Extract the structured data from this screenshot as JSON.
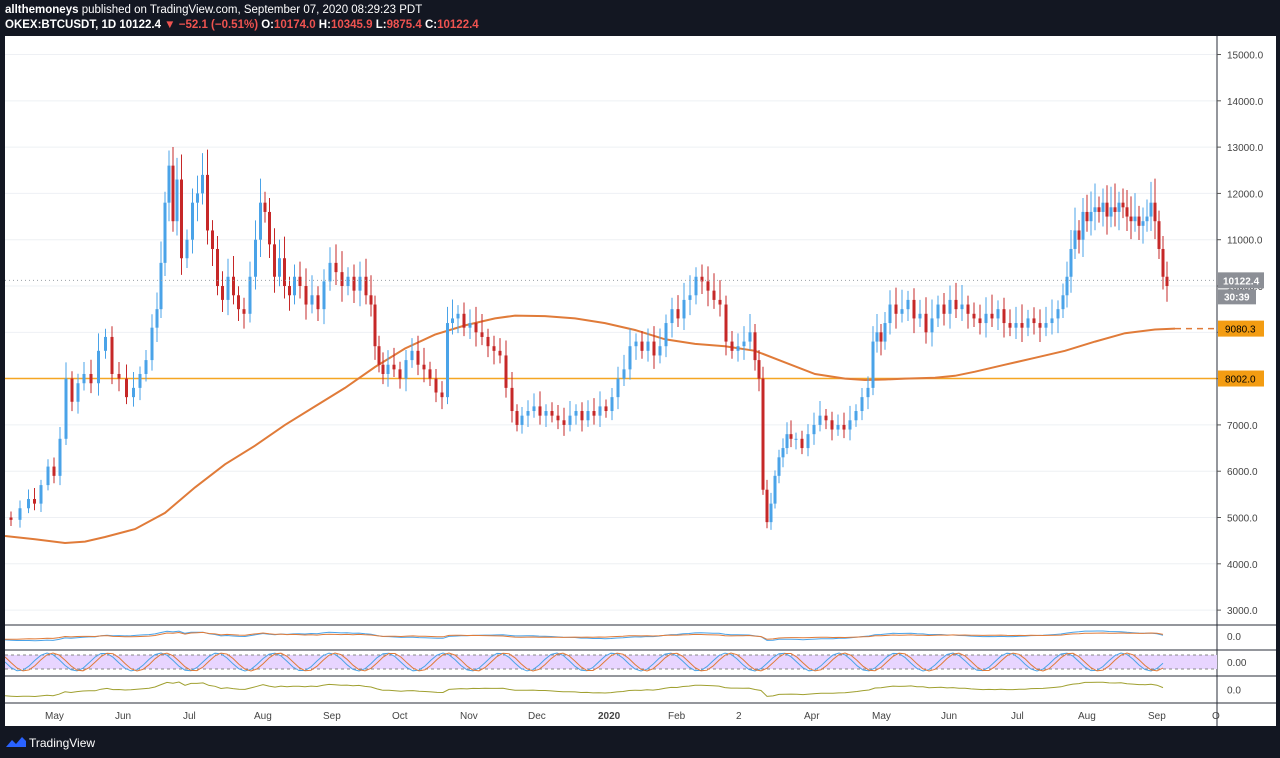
{
  "header": {
    "user": "allthemoneys",
    "published": "published on TradingView.com, September 07, 2020 08:29:23 PDT",
    "symbol": "OKEX:BTCUSDT, 1D",
    "last": "10122.4",
    "change": "▼ −52.1 (−0.51%)",
    "o_label": "O:",
    "o": "10174.0",
    "h_label": "H:",
    "h": "10345.9",
    "l_label": "L:",
    "l": "9875.4",
    "c_label": "C:",
    "c": "10122.4"
  },
  "footer": {
    "brand": "TradingView"
  },
  "colors": {
    "up": "#4aa3e8",
    "down": "#c62828",
    "ma": "#e07b39",
    "level": "#f5a623"
  },
  "chart_data": {
    "type": "candlestick",
    "ylim": [
      2700,
      15400
    ],
    "yticks": [
      "15000.0",
      "14000.0",
      "13000.0",
      "12000.0",
      "11000.0",
      "10000.0",
      "9000.0",
      "8000.0",
      "7000.0",
      "6000.0",
      "5000.0",
      "4000.0",
      "3000.0"
    ],
    "xticks": [
      "May",
      "Jun",
      "Jul",
      "Aug",
      "Sep",
      "Oct",
      "Nov",
      "Dec",
      "2020",
      "Feb",
      "2",
      "Apr",
      "May",
      "Jun",
      "Jul",
      "Aug",
      "Sep",
      "O"
    ],
    "price_label": "10122.4",
    "countdown": "30:39",
    "ma_label": "9080.3",
    "level_label": "8002.0",
    "level": 8002,
    "price_path": [
      [
        0,
        5000
      ],
      [
        8,
        4950
      ],
      [
        18,
        5200
      ],
      [
        25,
        5400
      ],
      [
        30,
        5300
      ],
      [
        38,
        5700
      ],
      [
        44,
        6100
      ],
      [
        50,
        5900
      ],
      [
        56,
        6700
      ],
      [
        62,
        8000
      ],
      [
        68,
        7500
      ],
      [
        74,
        7900
      ],
      [
        80,
        8100
      ],
      [
        88,
        7900
      ],
      [
        95,
        8600
      ],
      [
        102,
        8900
      ],
      [
        108,
        8100
      ],
      [
        116,
        8000
      ],
      [
        123,
        7600
      ],
      [
        130,
        7800
      ],
      [
        136,
        8100
      ],
      [
        142,
        8400
      ],
      [
        148,
        9100
      ],
      [
        152,
        9500
      ],
      [
        156,
        10500
      ],
      [
        160,
        11800
      ],
      [
        164,
        12600
      ],
      [
        168,
        11400
      ],
      [
        172,
        12300
      ],
      [
        177,
        10600
      ],
      [
        183,
        11000
      ],
      [
        188,
        11800
      ],
      [
        193,
        12000
      ],
      [
        198,
        12400
      ],
      [
        203,
        11200
      ],
      [
        208,
        10800
      ],
      [
        213,
        10000
      ],
      [
        218,
        9700
      ],
      [
        224,
        10200
      ],
      [
        229,
        9800
      ],
      [
        234,
        9500
      ],
      [
        240,
        9400
      ],
      [
        246,
        10200
      ],
      [
        251,
        11000
      ],
      [
        256,
        11800
      ],
      [
        260,
        11600
      ],
      [
        265,
        10900
      ],
      [
        270,
        10200
      ],
      [
        275,
        10600
      ],
      [
        280,
        10000
      ],
      [
        285,
        9800
      ],
      [
        290,
        10200
      ],
      [
        296,
        10000
      ],
      [
        302,
        9600
      ],
      [
        308,
        9800
      ],
      [
        314,
        9500
      ],
      [
        320,
        10100
      ],
      [
        326,
        10500
      ],
      [
        332,
        10300
      ],
      [
        338,
        10000
      ],
      [
        344,
        10200
      ],
      [
        350,
        9900
      ],
      [
        356,
        10200
      ],
      [
        362,
        9800
      ],
      [
        366,
        9600
      ],
      [
        370,
        8700
      ],
      [
        374,
        8300
      ],
      [
        378,
        8100
      ],
      [
        384,
        8300
      ],
      [
        390,
        8200
      ],
      [
        396,
        8000
      ],
      [
        402,
        8400
      ],
      [
        408,
        8600
      ],
      [
        414,
        8300
      ],
      [
        420,
        8200
      ],
      [
        426,
        8000
      ],
      [
        432,
        7700
      ],
      [
        438,
        7600
      ],
      [
        443,
        9200
      ],
      [
        448,
        9300
      ],
      [
        454,
        9400
      ],
      [
        460,
        9100
      ],
      [
        466,
        9200
      ],
      [
        472,
        9000
      ],
      [
        478,
        8900
      ],
      [
        484,
        8700
      ],
      [
        490,
        8600
      ],
      [
        496,
        8500
      ],
      [
        502,
        7800
      ],
      [
        508,
        7300
      ],
      [
        512,
        7000
      ],
      [
        518,
        7200
      ],
      [
        524,
        7300
      ],
      [
        530,
        7400
      ],
      [
        536,
        7200
      ],
      [
        542,
        7300
      ],
      [
        548,
        7200
      ],
      [
        554,
        7100
      ],
      [
        560,
        7000
      ],
      [
        566,
        7200
      ],
      [
        572,
        7300
      ],
      [
        578,
        7100
      ],
      [
        584,
        7300
      ],
      [
        590,
        7200
      ],
      [
        596,
        7400
      ],
      [
        602,
        7300
      ],
      [
        608,
        7600
      ],
      [
        614,
        8000
      ],
      [
        620,
        8200
      ],
      [
        626,
        8700
      ],
      [
        632,
        8800
      ],
      [
        638,
        8600
      ],
      [
        644,
        8800
      ],
      [
        650,
        8500
      ],
      [
        656,
        8700
      ],
      [
        662,
        9200
      ],
      [
        668,
        9500
      ],
      [
        674,
        9300
      ],
      [
        680,
        9700
      ],
      [
        686,
        9800
      ],
      [
        692,
        10200
      ],
      [
        698,
        10100
      ],
      [
        704,
        9900
      ],
      [
        710,
        9700
      ],
      [
        716,
        9600
      ],
      [
        722,
        8800
      ],
      [
        728,
        8600
      ],
      [
        734,
        8700
      ],
      [
        740,
        8800
      ],
      [
        746,
        9000
      ],
      [
        750,
        8400
      ],
      [
        754,
        8000
      ],
      [
        758,
        5600
      ],
      [
        762,
        4900
      ],
      [
        766,
        5300
      ],
      [
        770,
        5900
      ],
      [
        774,
        6300
      ],
      [
        778,
        6500
      ],
      [
        782,
        6800
      ],
      [
        786,
        6700
      ],
      [
        792,
        6700
      ],
      [
        798,
        6500
      ],
      [
        804,
        6800
      ],
      [
        810,
        7000
      ],
      [
        816,
        7200
      ],
      [
        822,
        7100
      ],
      [
        828,
        6900
      ],
      [
        834,
        7000
      ],
      [
        840,
        6900
      ],
      [
        846,
        7100
      ],
      [
        852,
        7300
      ],
      [
        858,
        7600
      ],
      [
        864,
        7800
      ],
      [
        868,
        8800
      ],
      [
        872,
        9000
      ],
      [
        876,
        8800
      ],
      [
        880,
        9200
      ],
      [
        886,
        9600
      ],
      [
        892,
        9400
      ],
      [
        898,
        9500
      ],
      [
        904,
        9700
      ],
      [
        910,
        9300
      ],
      [
        916,
        9400
      ],
      [
        922,
        9000
      ],
      [
        928,
        9300
      ],
      [
        934,
        9600
      ],
      [
        940,
        9400
      ],
      [
        946,
        9700
      ],
      [
        952,
        9500
      ],
      [
        958,
        9600
      ],
      [
        964,
        9400
      ],
      [
        970,
        9300
      ],
      [
        976,
        9200
      ],
      [
        982,
        9400
      ],
      [
        988,
        9300
      ],
      [
        994,
        9500
      ],
      [
        1000,
        9200
      ],
      [
        1006,
        9100
      ],
      [
        1012,
        9200
      ],
      [
        1018,
        9100
      ],
      [
        1024,
        9300
      ],
      [
        1030,
        9200
      ],
      [
        1036,
        9100
      ],
      [
        1042,
        9200
      ],
      [
        1048,
        9300
      ],
      [
        1054,
        9500
      ],
      [
        1058,
        9800
      ],
      [
        1062,
        10200
      ],
      [
        1066,
        10800
      ],
      [
        1070,
        11200
      ],
      [
        1074,
        11000
      ],
      [
        1078,
        11600
      ],
      [
        1082,
        11400
      ],
      [
        1086,
        11600
      ],
      [
        1090,
        11700
      ],
      [
        1094,
        11600
      ],
      [
        1098,
        11800
      ],
      [
        1102,
        11500
      ],
      [
        1106,
        11700
      ],
      [
        1110,
        11600
      ],
      [
        1114,
        11800
      ],
      [
        1118,
        11700
      ],
      [
        1122,
        11500
      ],
      [
        1126,
        11400
      ],
      [
        1130,
        11500
      ],
      [
        1134,
        11300
      ],
      [
        1138,
        11400
      ],
      [
        1142,
        11500
      ],
      [
        1146,
        11800
      ],
      [
        1150,
        11400
      ],
      [
        1154,
        10800
      ],
      [
        1158,
        10200
      ],
      [
        1162,
        10000
      ]
    ],
    "ma_path": [
      [
        0,
        4600
      ],
      [
        30,
        4530
      ],
      [
        60,
        4450
      ],
      [
        80,
        4480
      ],
      [
        100,
        4580
      ],
      [
        130,
        4750
      ],
      [
        160,
        5100
      ],
      [
        190,
        5650
      ],
      [
        220,
        6150
      ],
      [
        250,
        6550
      ],
      [
        280,
        7000
      ],
      [
        310,
        7400
      ],
      [
        340,
        7800
      ],
      [
        370,
        8250
      ],
      [
        400,
        8650
      ],
      [
        430,
        8950
      ],
      [
        460,
        9150
      ],
      [
        490,
        9300
      ],
      [
        510,
        9360
      ],
      [
        540,
        9350
      ],
      [
        570,
        9300
      ],
      [
        600,
        9200
      ],
      [
        630,
        9050
      ],
      [
        660,
        8850
      ],
      [
        690,
        8750
      ],
      [
        720,
        8700
      ],
      [
        750,
        8600
      ],
      [
        780,
        8350
      ],
      [
        810,
        8100
      ],
      [
        840,
        8000
      ],
      [
        860,
        7970
      ],
      [
        880,
        7980
      ],
      [
        900,
        8000
      ],
      [
        930,
        8020
      ],
      [
        950,
        8060
      ],
      [
        970,
        8150
      ],
      [
        1000,
        8300
      ],
      [
        1030,
        8450
      ],
      [
        1060,
        8600
      ],
      [
        1090,
        8800
      ],
      [
        1120,
        8980
      ],
      [
        1150,
        9060
      ],
      [
        1170,
        9080
      ]
    ],
    "indicators": {
      "macd_label": "0.0",
      "stoch_label": "0.00",
      "osc_label": "0.0"
    }
  }
}
